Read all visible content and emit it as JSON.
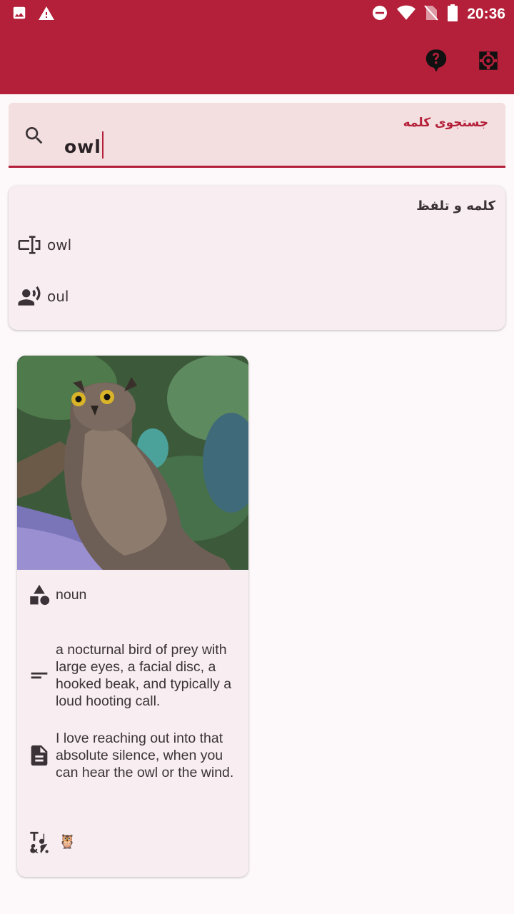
{
  "status_bar": {
    "time": "20:36",
    "icons": [
      "image-icon",
      "warning-icon",
      "do-not-disturb-icon",
      "wifi-icon",
      "no-sim-icon",
      "battery-icon"
    ]
  },
  "app_bar": {
    "actions": [
      "help-icon",
      "settings-icon"
    ],
    "background": "#b41f39"
  },
  "search": {
    "label": "جستجوی کلمه",
    "value": "owl"
  },
  "word_card": {
    "title": "کلمه و تلفظ",
    "word": "owl",
    "pronunciation": "oul"
  },
  "detail_card": {
    "part_of_speech": "noun",
    "definition": "a nocturnal bird of prey with large eyes, a facial disc, a hooked beak, and typically a loud hooting call.",
    "example": "I love reaching out into that absolute silence, when you can hear the owl or the wind.",
    "emoji": "🦉"
  }
}
